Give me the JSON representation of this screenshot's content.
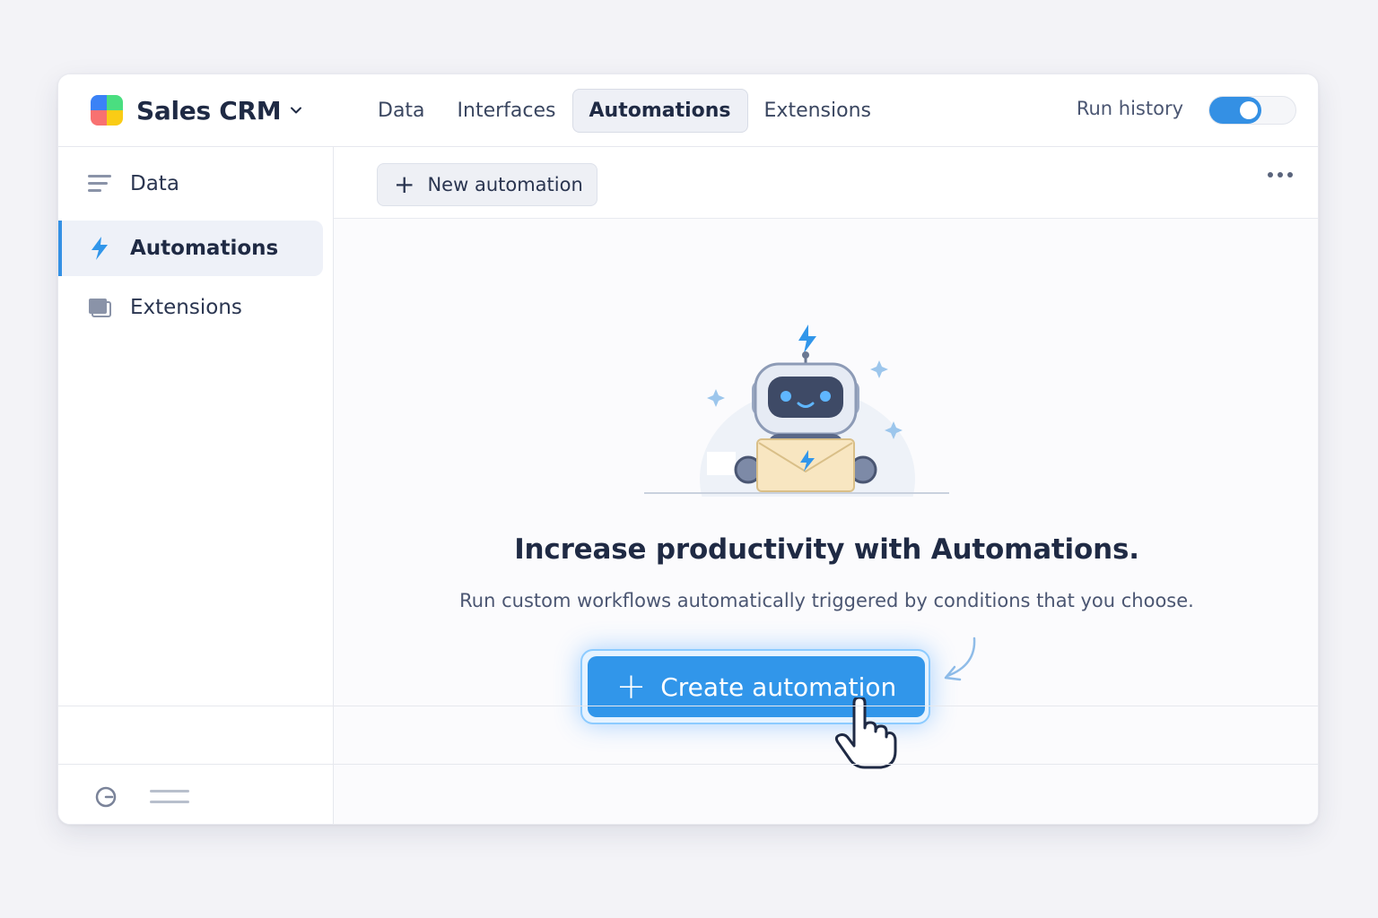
{
  "app": {
    "title": "Sales CRM"
  },
  "nav": {
    "tabs": [
      {
        "label": "Data"
      },
      {
        "label": "Interfaces"
      },
      {
        "label": "Automations",
        "active": true
      },
      {
        "label": "Extensions"
      }
    ]
  },
  "header": {
    "run_history_label": "Run history",
    "run_history_enabled": true
  },
  "sidebar": {
    "items": [
      {
        "label": "Data",
        "icon": "lines-icon"
      },
      {
        "label": "Automations",
        "icon": "lightning-icon",
        "active": true
      },
      {
        "label": "Extensions",
        "icon": "extension-icon"
      }
    ]
  },
  "toolbar": {
    "new_automation_label": "New automation"
  },
  "empty_state": {
    "headline": "Increase productivity with Automations.",
    "description": "Run custom workflows automatically triggered by conditions that you choose.",
    "cta_label": "Create automation"
  },
  "colors": {
    "accent": "#3196ea",
    "active_bg": "#eef1f8"
  }
}
